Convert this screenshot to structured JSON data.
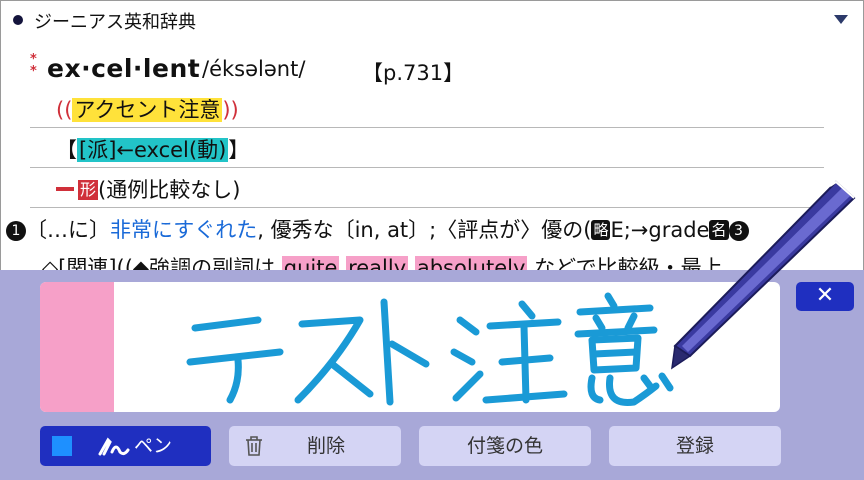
{
  "header": {
    "title": "ジーニアス英和辞典"
  },
  "entry": {
    "star_marks": "**",
    "headword": "ex·cel·lent",
    "pronunciation": "/éksələnt/",
    "page_ref": "【p.731】",
    "note_open": "((",
    "note_label": "アクセント注意",
    "note_close": "))",
    "derivation_open": "【",
    "derivation_label": "[派]←excel(動)",
    "derivation_close": "】",
    "pos_label": "形",
    "pos_note": "(通例比較なし)",
    "sense_number": "1",
    "sense_prefix": "〔…に〕",
    "sense_highlight": "非常にすぐれた",
    "sense_rest": ", 優秀な〔in, at〕;〈評点が〉優の(",
    "abbr_label": "略",
    "abbr_rest": "E;→grade",
    "noun_label": "名",
    "noun_num": "3",
    "related_prefix": "◇[関連]((◆強調の副詞は ",
    "related_w1": "quite",
    "related_w2": "really",
    "related_w3": "absolutely",
    "related_rest": " などで比較級・最上"
  },
  "handwriting": {
    "ink_color": "#1a9ad6",
    "close_label": "✕"
  },
  "toolbar": {
    "pen_label": "ペン",
    "pen_color": "#1e90ff",
    "delete_label": "削除",
    "sticky_color_label": "付箋の色",
    "register_label": "登録"
  },
  "colors": {
    "accent_red": "#d0303a",
    "highlight_yellow": "#ffe23a",
    "highlight_cyan": "#22c4c8",
    "highlight_pink": "#f6a0c8",
    "panel_bg": "#a8a8d8",
    "button_blue": "#1f2fc0"
  }
}
